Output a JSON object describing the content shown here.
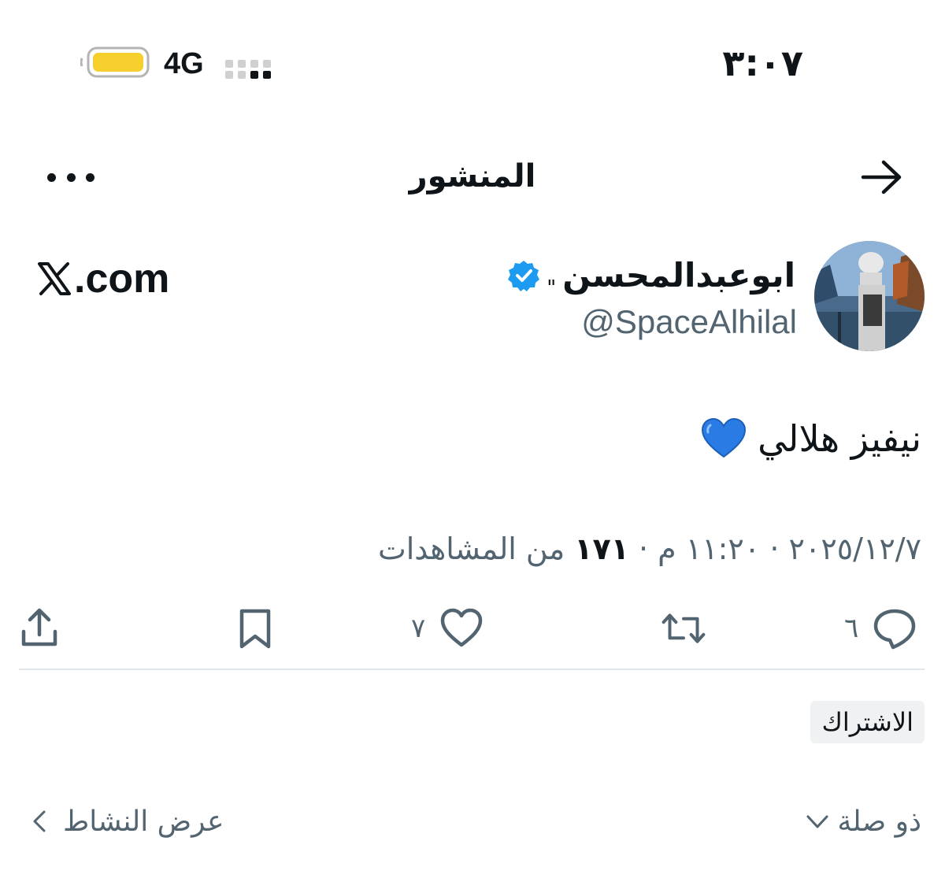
{
  "status_bar": {
    "time": "٣:٠٧",
    "network": "4G",
    "battery_color": "#f5d02c"
  },
  "nav": {
    "title": "المنشور"
  },
  "author": {
    "name": "ابوعبدالمحسن",
    "name_mark": "\"",
    "handle": "@SpaceAlhilal",
    "verified": true,
    "site": ".com"
  },
  "tweet": {
    "text": "نيفيز هلالي",
    "emoji": "blue-heart"
  },
  "meta": {
    "date": "٢٠٢٥/١٢/٧",
    "time": "١١:٢٠ م",
    "separator": "·",
    "views_count": "١٧١",
    "views_label": "من المشاهدات"
  },
  "actions": {
    "replies": "٦",
    "likes": "٧"
  },
  "subscribe_label": "الاشتراك",
  "related_label": "ذو صلة",
  "activity_label": "عرض النشاط",
  "colors": {
    "text": "#0f1419",
    "secondary": "#536471",
    "verified": "#1d9bf0",
    "heart": "#2a7be4"
  }
}
